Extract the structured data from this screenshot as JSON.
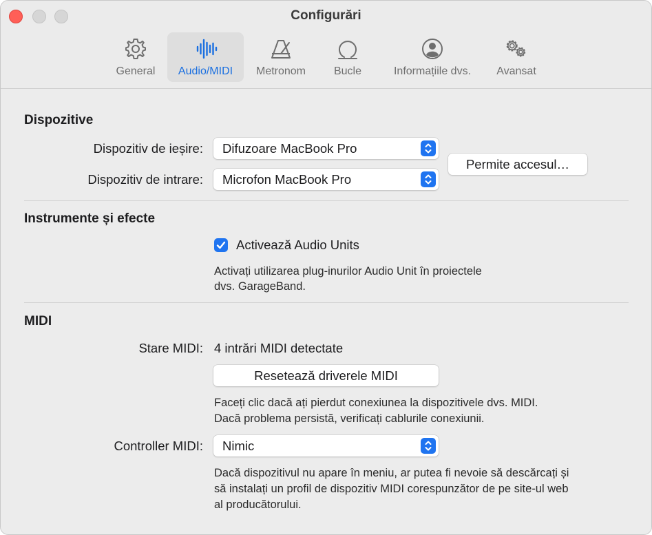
{
  "window": {
    "title": "Configurări"
  },
  "toolbar": {
    "tabs": [
      {
        "label": "General",
        "icon": "gear-icon",
        "active": false
      },
      {
        "label": "Audio/MIDI",
        "icon": "waveform-icon",
        "active": true
      },
      {
        "label": "Metronom",
        "icon": "metronome-icon",
        "active": false
      },
      {
        "label": "Bucle",
        "icon": "loop-icon",
        "active": false
      },
      {
        "label": "Informațiile dvs.",
        "icon": "person-icon",
        "active": false
      },
      {
        "label": "Avansat",
        "icon": "gears-icon",
        "active": false
      }
    ]
  },
  "devices": {
    "title": "Dispozitive",
    "output_label": "Dispozitiv de ieșire:",
    "output_value": "Difuzoare MacBook Pro",
    "input_label": "Dispozitiv de intrare:",
    "input_value": "Microfon MacBook Pro",
    "permit_button": "Permite accesul…"
  },
  "instruments": {
    "title": "Instrumente și efecte",
    "audio_units_label": "Activează Audio Units",
    "audio_units_checked": true,
    "help_line1": "Activați utilizarea plug-inurilor Audio Unit în proiectele",
    "help_line2": "dvs. GarageBand."
  },
  "midi": {
    "title": "MIDI",
    "status_label": "Stare MIDI:",
    "status_value": "4 intrări MIDI detectate",
    "reset_button": "Resetează driverele MIDI",
    "reset_help_line1": "Faceți clic dacă ați pierdut conexiunea la dispozitivele dvs. MIDI.",
    "reset_help_line2": "Dacă problema persistă, verificați cablurile conexiunii.",
    "controller_label": "Controller MIDI:",
    "controller_value": "Nimic",
    "controller_help_line1": "Dacă dispozitivul nu apare în meniu, ar putea fi nevoie să descărcați și",
    "controller_help_line2": "să instalați un profil de dispozitiv MIDI corespunzător de pe site-ul web",
    "controller_help_line3": "al producătorului."
  },
  "colors": {
    "accent": "#1f74f0",
    "close": "#ff5f57"
  }
}
